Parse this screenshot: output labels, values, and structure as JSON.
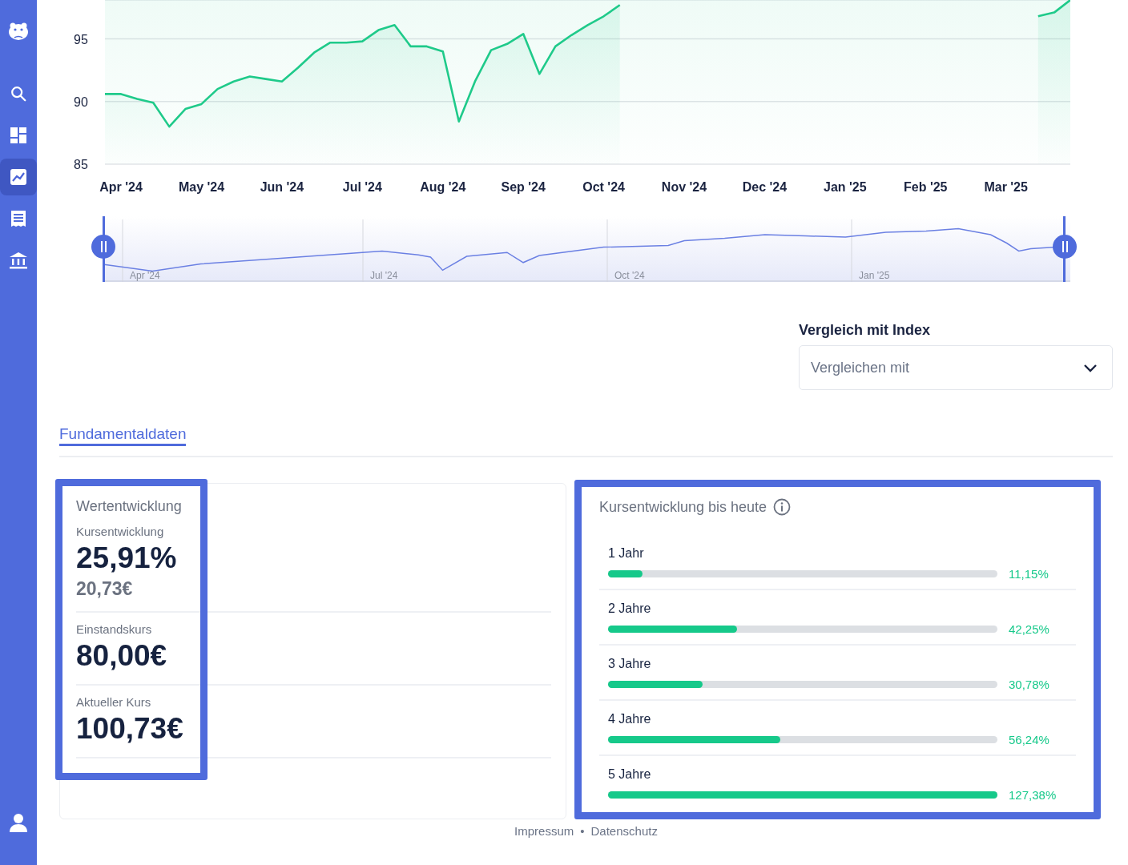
{
  "sidebar": {
    "items": [
      {
        "kind": "search",
        "selected": false
      },
      {
        "kind": "dashboard",
        "selected": false
      },
      {
        "kind": "chart",
        "selected": true
      },
      {
        "kind": "list",
        "selected": false
      },
      {
        "kind": "bank",
        "selected": false
      },
      {
        "kind": "user",
        "selected": false
      }
    ]
  },
  "price_chart": {
    "chart_data": {
      "type": "area",
      "ylim": [
        85,
        98.1
      ],
      "yticks": [
        85,
        90,
        95
      ],
      "categories": [
        null,
        "Apr '24",
        null,
        null,
        null,
        null,
        "May '24",
        null,
        null,
        null,
        null,
        "Jun '24",
        null,
        null,
        null,
        null,
        "Jul '24",
        null,
        null,
        null,
        null,
        "Aug '24",
        null,
        null,
        null,
        null,
        "Sep '24",
        null,
        null,
        null,
        null,
        "Oct '24",
        null,
        null,
        null,
        null,
        "Nov '24",
        null,
        null,
        null,
        null,
        "Dec '24",
        null,
        null,
        null,
        null,
        "Jan '25",
        null,
        null,
        null,
        null,
        "Feb '25",
        null,
        null,
        null,
        null,
        "Mar '25",
        null,
        null,
        null,
        null
      ],
      "series": [
        {
          "color": "#1fca8a",
          "values": [
            90.6,
            90.6,
            90.2,
            89.9,
            88.0,
            89.4,
            89.8,
            91.0,
            91.6,
            92.0,
            91.8,
            91.6,
            92.7,
            93.9,
            94.7,
            94.7,
            94.8,
            95.7,
            96.1,
            94.4,
            94.4,
            94.0,
            88.4,
            91.6,
            94.1,
            94.6,
            95.4,
            92.2,
            94.4,
            95.3,
            96.1,
            96.8,
            97.7,
            null,
            null,
            null,
            null,
            null,
            null,
            null,
            null,
            null,
            null,
            null,
            null,
            null,
            null,
            null,
            null,
            null,
            null,
            null,
            null,
            null,
            null,
            null,
            null,
            null,
            96.8,
            97.1,
            98.1
          ]
        }
      ]
    }
  },
  "navigator": {
    "labels": [
      "Apr '24",
      "Jul '24",
      "Oct '24",
      "Jan '25"
    ]
  },
  "compare": {
    "label": "Vergleich mit Index",
    "placeholder": "Vergleichen mit"
  },
  "tabs": [
    {
      "label": "Fundamentaldaten",
      "selected": true
    }
  ],
  "value_card": {
    "title": "Wertentwicklung",
    "metrics": [
      {
        "label": "Kursentwicklung",
        "value": "25,91%",
        "sub": "20,73€"
      },
      {
        "label": "Einstandskurs",
        "value": "80,00€"
      },
      {
        "label": "Aktueller Kurs",
        "value": "100,73€"
      }
    ]
  },
  "performance_card": {
    "title": "Kursentwicklung bis heute",
    "rows": [
      {
        "label": "1 Jahr",
        "level": 0.088,
        "reading": "11,15%"
      },
      {
        "label": "2 Jahre",
        "level": 0.332,
        "reading": "42,25%"
      },
      {
        "label": "3 Jahre",
        "level": 0.242,
        "reading": "30,78%"
      },
      {
        "label": "4 Jahre",
        "level": 0.442,
        "reading": "56,24%"
      },
      {
        "label": "5 Jahre",
        "level": 1.0,
        "reading": "127,38%"
      }
    ]
  },
  "footer": {
    "links": [
      "Impressum",
      "Datenschutz"
    ],
    "separator": "•"
  }
}
